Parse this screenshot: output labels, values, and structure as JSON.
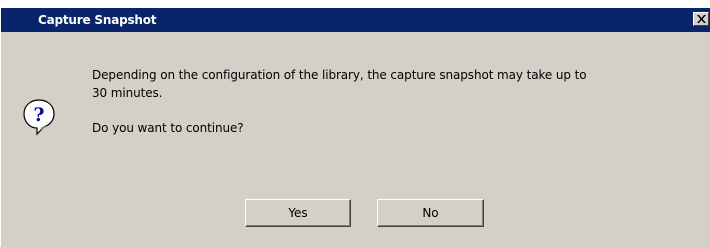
{
  "window": {
    "title": "Capture Snapshot",
    "close_glyph": "×"
  },
  "message": {
    "line1": "Depending on the configuration of the library, the capture snapshot may take up to",
    "line2": "30 minutes.",
    "question": "Do you want to continue?"
  },
  "icons": {
    "dialog_icon": "question-icon",
    "close_icon": "close-icon"
  },
  "buttons": {
    "yes_label": "Yes",
    "no_label": "No"
  },
  "colors": {
    "titlebar": "#0a246a",
    "dialog_bg": "#d4d0c8",
    "icon_fill": "#ffffff",
    "icon_glyph": "#0a0aa0"
  }
}
